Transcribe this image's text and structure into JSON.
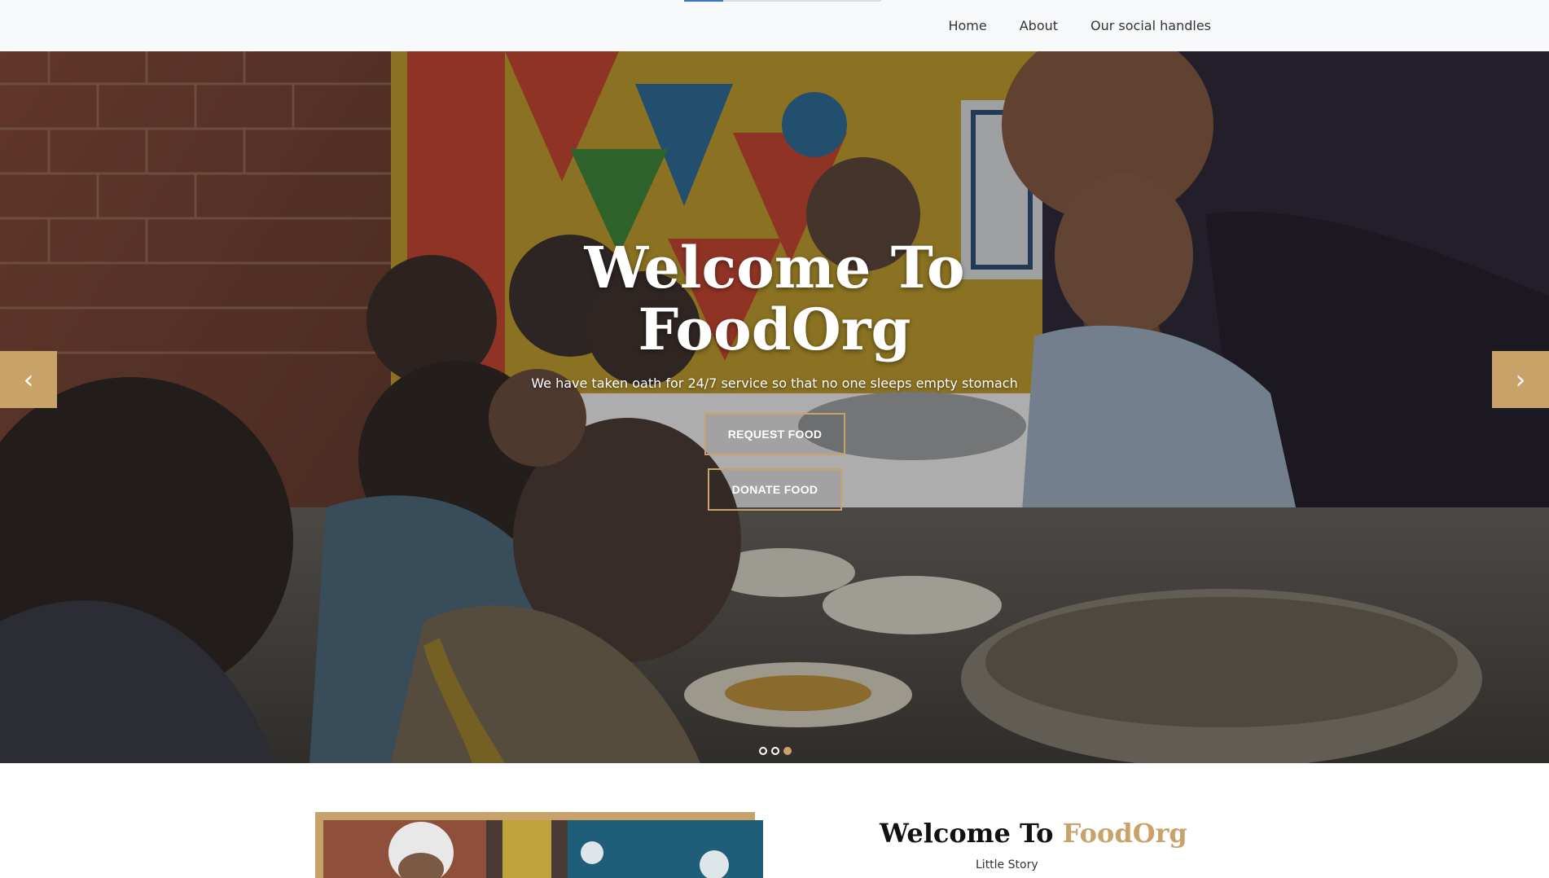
{
  "nav": {
    "items": [
      {
        "label": "Home"
      },
      {
        "label": "About"
      },
      {
        "label": "Our social handles"
      }
    ],
    "progress_fraction": 0.2
  },
  "hero": {
    "title_line1": "Welcome To",
    "title_line2": "FoodOrg",
    "subtitle": "We have taken oath for 24/7 service so that no one sleeps empty stomach",
    "buttons": {
      "request": "REQUEST FOOD",
      "donate": "DONATE FOOD"
    },
    "prev_icon": "chevron-left-icon",
    "next_icon": "chevron-right-icon",
    "slides_total": 3,
    "active_slide": 3
  },
  "about": {
    "heading_prefix": "Welcome To ",
    "heading_brand": "FoodOrg",
    "subheading": "Little Story"
  },
  "colors": {
    "accent": "#c9a26a",
    "nav_bg": "#f7f9fb",
    "progress": "#3a78c3"
  }
}
